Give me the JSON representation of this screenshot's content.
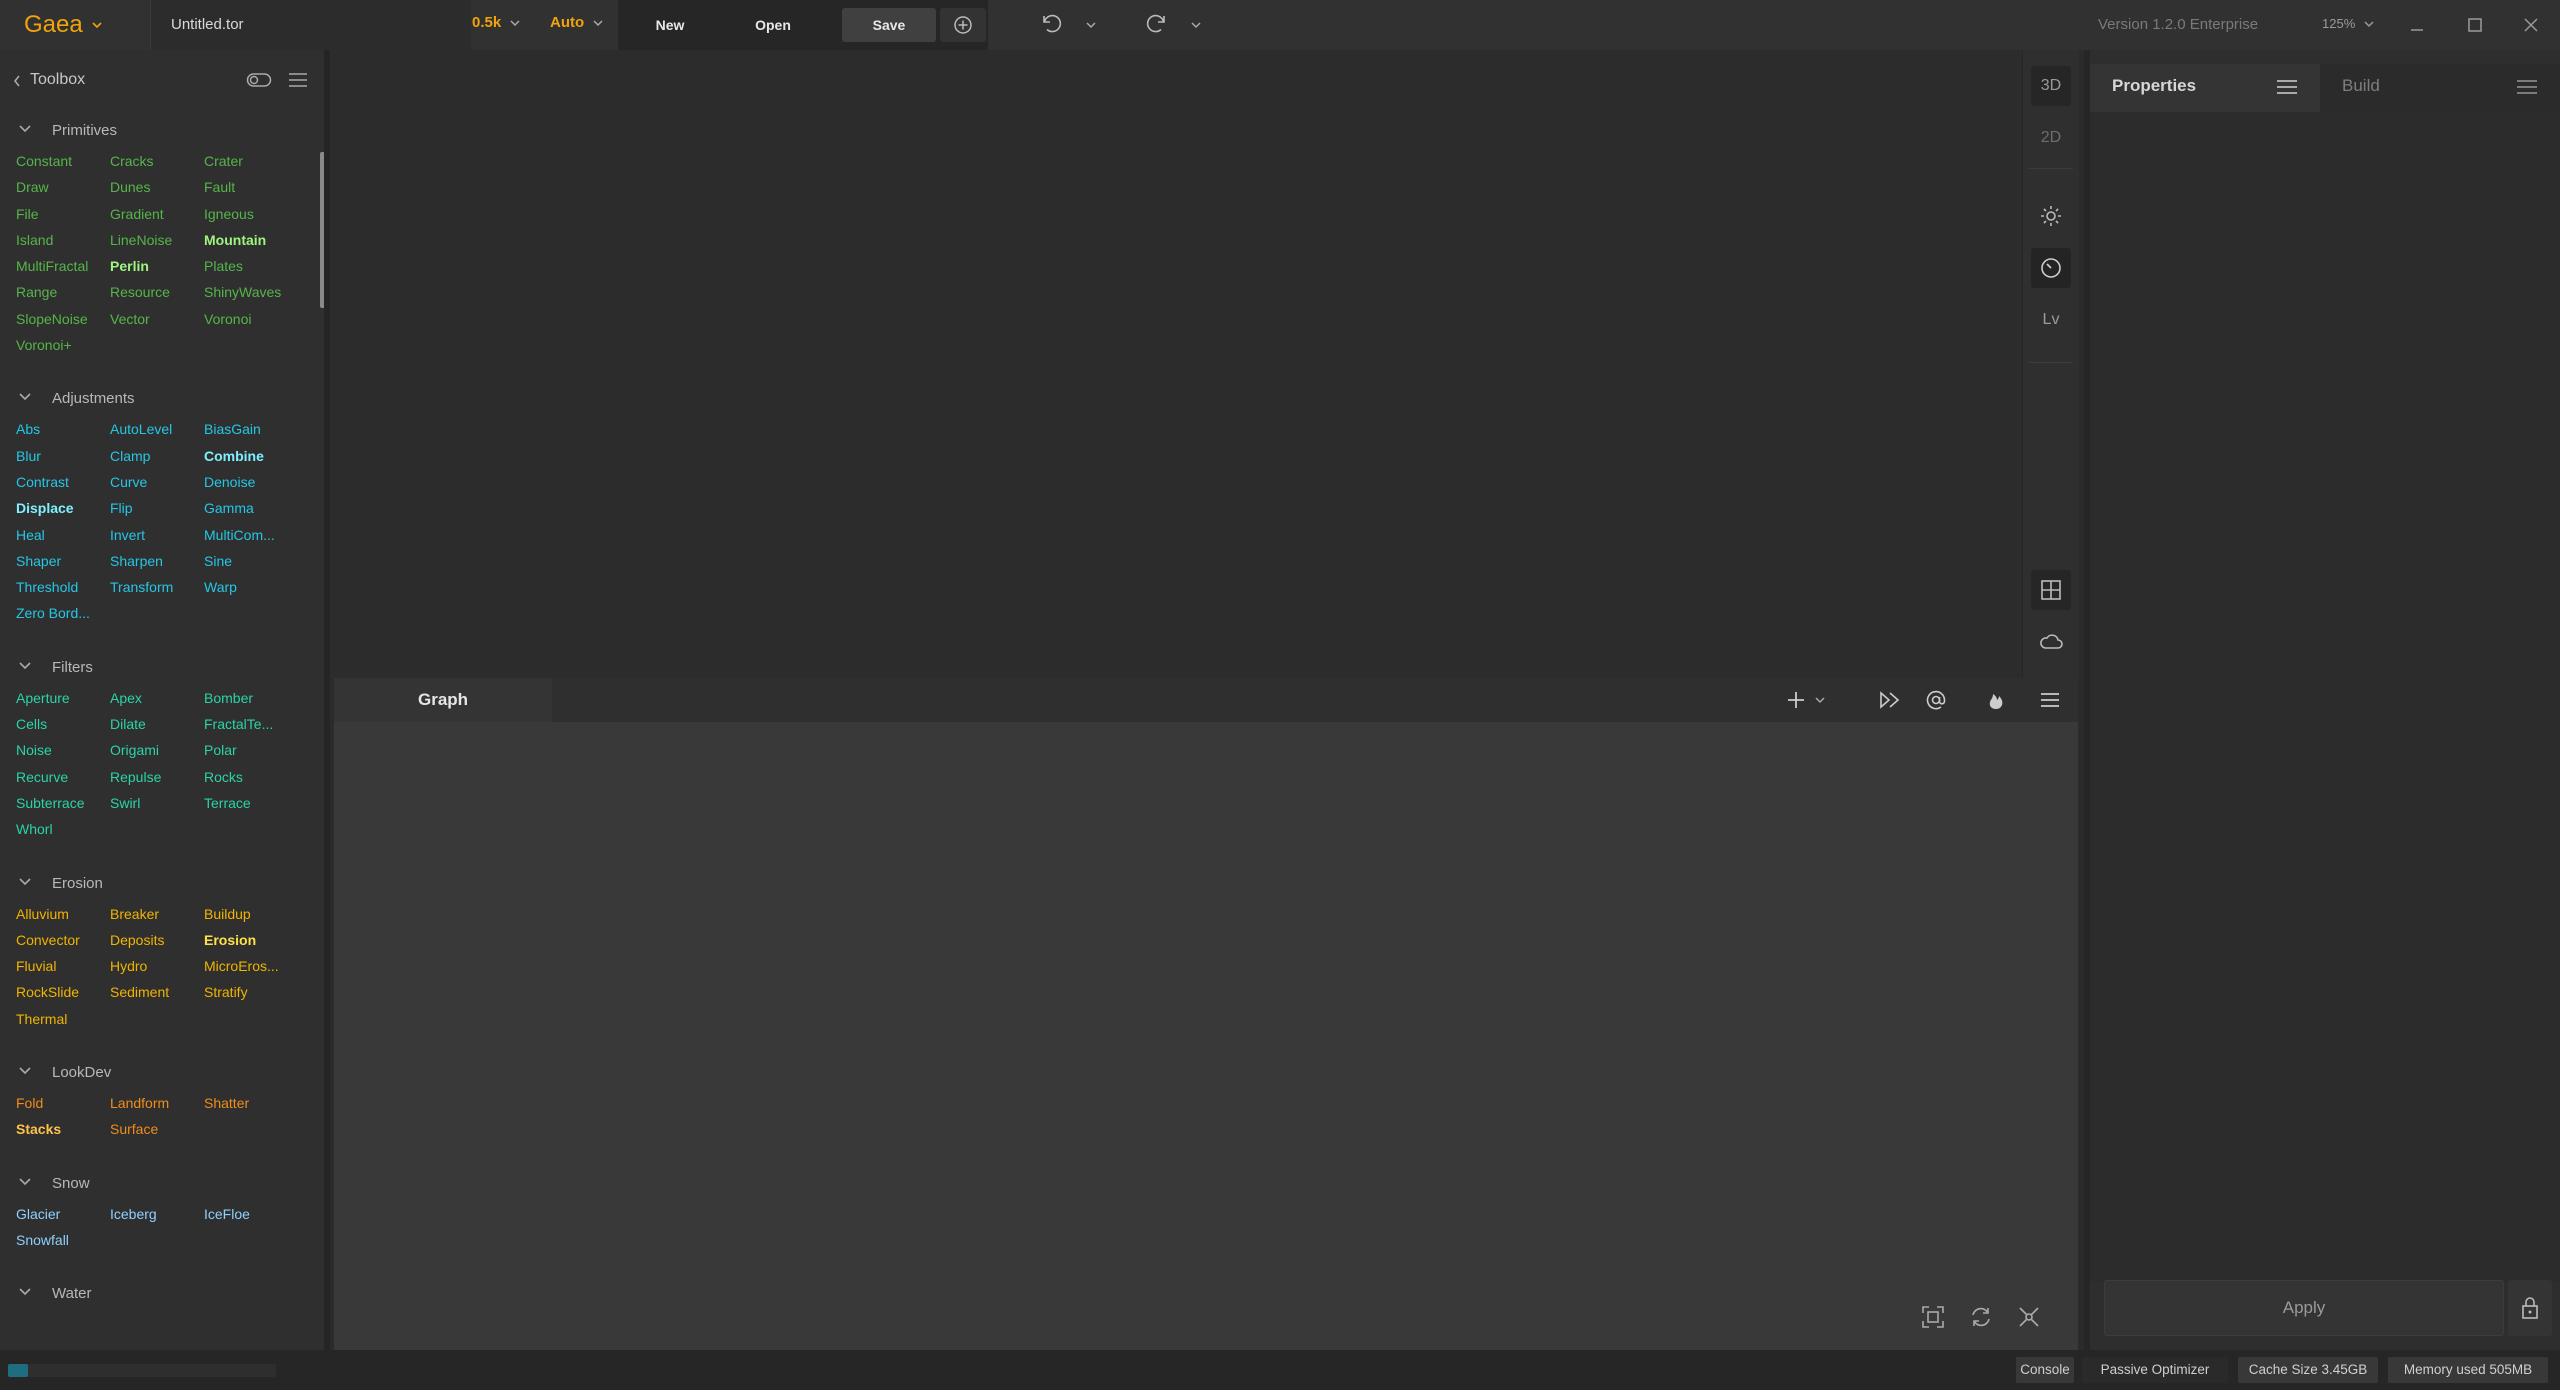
{
  "app": {
    "name": "Gaea",
    "file_name": "Untitled.tor",
    "resolution": "0.5k",
    "mode": "Auto",
    "version": "Version 1.2.0 Enterprise",
    "zoom": "125%"
  },
  "toolbar": {
    "new_label": "New",
    "open_label": "Open",
    "save_label": "Save"
  },
  "toolbox": {
    "title": "Toolbox",
    "sections": [
      {
        "name": "Primitives",
        "color": "#56b54a",
        "items": [
          {
            "label": "Constant"
          },
          {
            "label": "Cracks"
          },
          {
            "label": "Crater"
          },
          {
            "label": "Draw"
          },
          {
            "label": "Dunes"
          },
          {
            "label": "Fault"
          },
          {
            "label": "File"
          },
          {
            "label": "Gradient"
          },
          {
            "label": "Igneous"
          },
          {
            "label": "Island"
          },
          {
            "label": "LineNoise"
          },
          {
            "label": "Mountain",
            "bold": true
          },
          {
            "label": "MultiFractal"
          },
          {
            "label": "Perlin",
            "bold": true
          },
          {
            "label": "Plates"
          },
          {
            "label": "Range"
          },
          {
            "label": "Resource"
          },
          {
            "label": "ShinyWaves"
          },
          {
            "label": "SlopeNoise"
          },
          {
            "label": "Vector"
          },
          {
            "label": "Voronoi"
          },
          {
            "label": "Voronoi+"
          }
        ]
      },
      {
        "name": "Adjustments",
        "color": "#25c7e6",
        "items": [
          {
            "label": "Abs"
          },
          {
            "label": "AutoLevel"
          },
          {
            "label": "BiasGain"
          },
          {
            "label": "Blur"
          },
          {
            "label": "Clamp"
          },
          {
            "label": "Combine",
            "bold": true
          },
          {
            "label": "Contrast"
          },
          {
            "label": "Curve"
          },
          {
            "label": "Denoise"
          },
          {
            "label": "Displace",
            "bold": true
          },
          {
            "label": "Flip"
          },
          {
            "label": "Gamma"
          },
          {
            "label": "Heal"
          },
          {
            "label": "Invert"
          },
          {
            "label": "MultiCom..."
          },
          {
            "label": "Shaper"
          },
          {
            "label": "Sharpen"
          },
          {
            "label": "Sine"
          },
          {
            "label": "Threshold"
          },
          {
            "label": "Transform"
          },
          {
            "label": "Warp"
          },
          {
            "label": "Zero Bord..."
          }
        ]
      },
      {
        "name": "Filters",
        "color": "#2ad4a6",
        "items": [
          {
            "label": "Aperture"
          },
          {
            "label": "Apex"
          },
          {
            "label": "Bomber"
          },
          {
            "label": "Cells"
          },
          {
            "label": "Dilate"
          },
          {
            "label": "FractalTe..."
          },
          {
            "label": "Noise"
          },
          {
            "label": "Origami"
          },
          {
            "label": "Polar"
          },
          {
            "label": "Recurve"
          },
          {
            "label": "Repulse"
          },
          {
            "label": "Rocks"
          },
          {
            "label": "Subterrace"
          },
          {
            "label": "Swirl"
          },
          {
            "label": "Terrace"
          },
          {
            "label": "Whorl"
          }
        ]
      },
      {
        "name": "Erosion",
        "color": "#f0b400",
        "items": [
          {
            "label": "Alluvium"
          },
          {
            "label": "Breaker"
          },
          {
            "label": "Buildup"
          },
          {
            "label": "Convector"
          },
          {
            "label": "Deposits"
          },
          {
            "label": "Erosion",
            "bold": true
          },
          {
            "label": "Fluvial"
          },
          {
            "label": "Hydro"
          },
          {
            "label": "MicroEros..."
          },
          {
            "label": "RockSlide"
          },
          {
            "label": "Sediment"
          },
          {
            "label": "Stratify"
          },
          {
            "label": "Thermal"
          }
        ]
      },
      {
        "name": "LookDev",
        "color": "#f08c1a",
        "items": [
          {
            "label": "Fold"
          },
          {
            "label": "Landform"
          },
          {
            "label": "Shatter"
          },
          {
            "label": "Stacks",
            "bold": true
          },
          {
            "label": "Surface"
          }
        ]
      },
      {
        "name": "Snow",
        "color": "#8fd0ff",
        "items": [
          {
            "label": "Glacier"
          },
          {
            "label": "Iceberg"
          },
          {
            "label": "IceFloe"
          },
          {
            "label": "Snowfall"
          }
        ]
      },
      {
        "name": "Water",
        "color": "#4aa3df",
        "items": []
      }
    ]
  },
  "viewport_tools": {
    "btn_3d": "3D",
    "btn_2d": "2D",
    "btn_lv": "Lv"
  },
  "graph": {
    "tab_label": "Graph"
  },
  "properties": {
    "tab_properties": "Properties",
    "tab_build": "Build",
    "apply_label": "Apply"
  },
  "status": {
    "console": "Console",
    "optimizer": "Passive Optimizer",
    "cache": "Cache Size 3.45GB",
    "memory": "Memory used 505MB",
    "progress": 0.074
  },
  "colors": {
    "accent": "#f0a30a",
    "progress": "#1f6e80"
  }
}
